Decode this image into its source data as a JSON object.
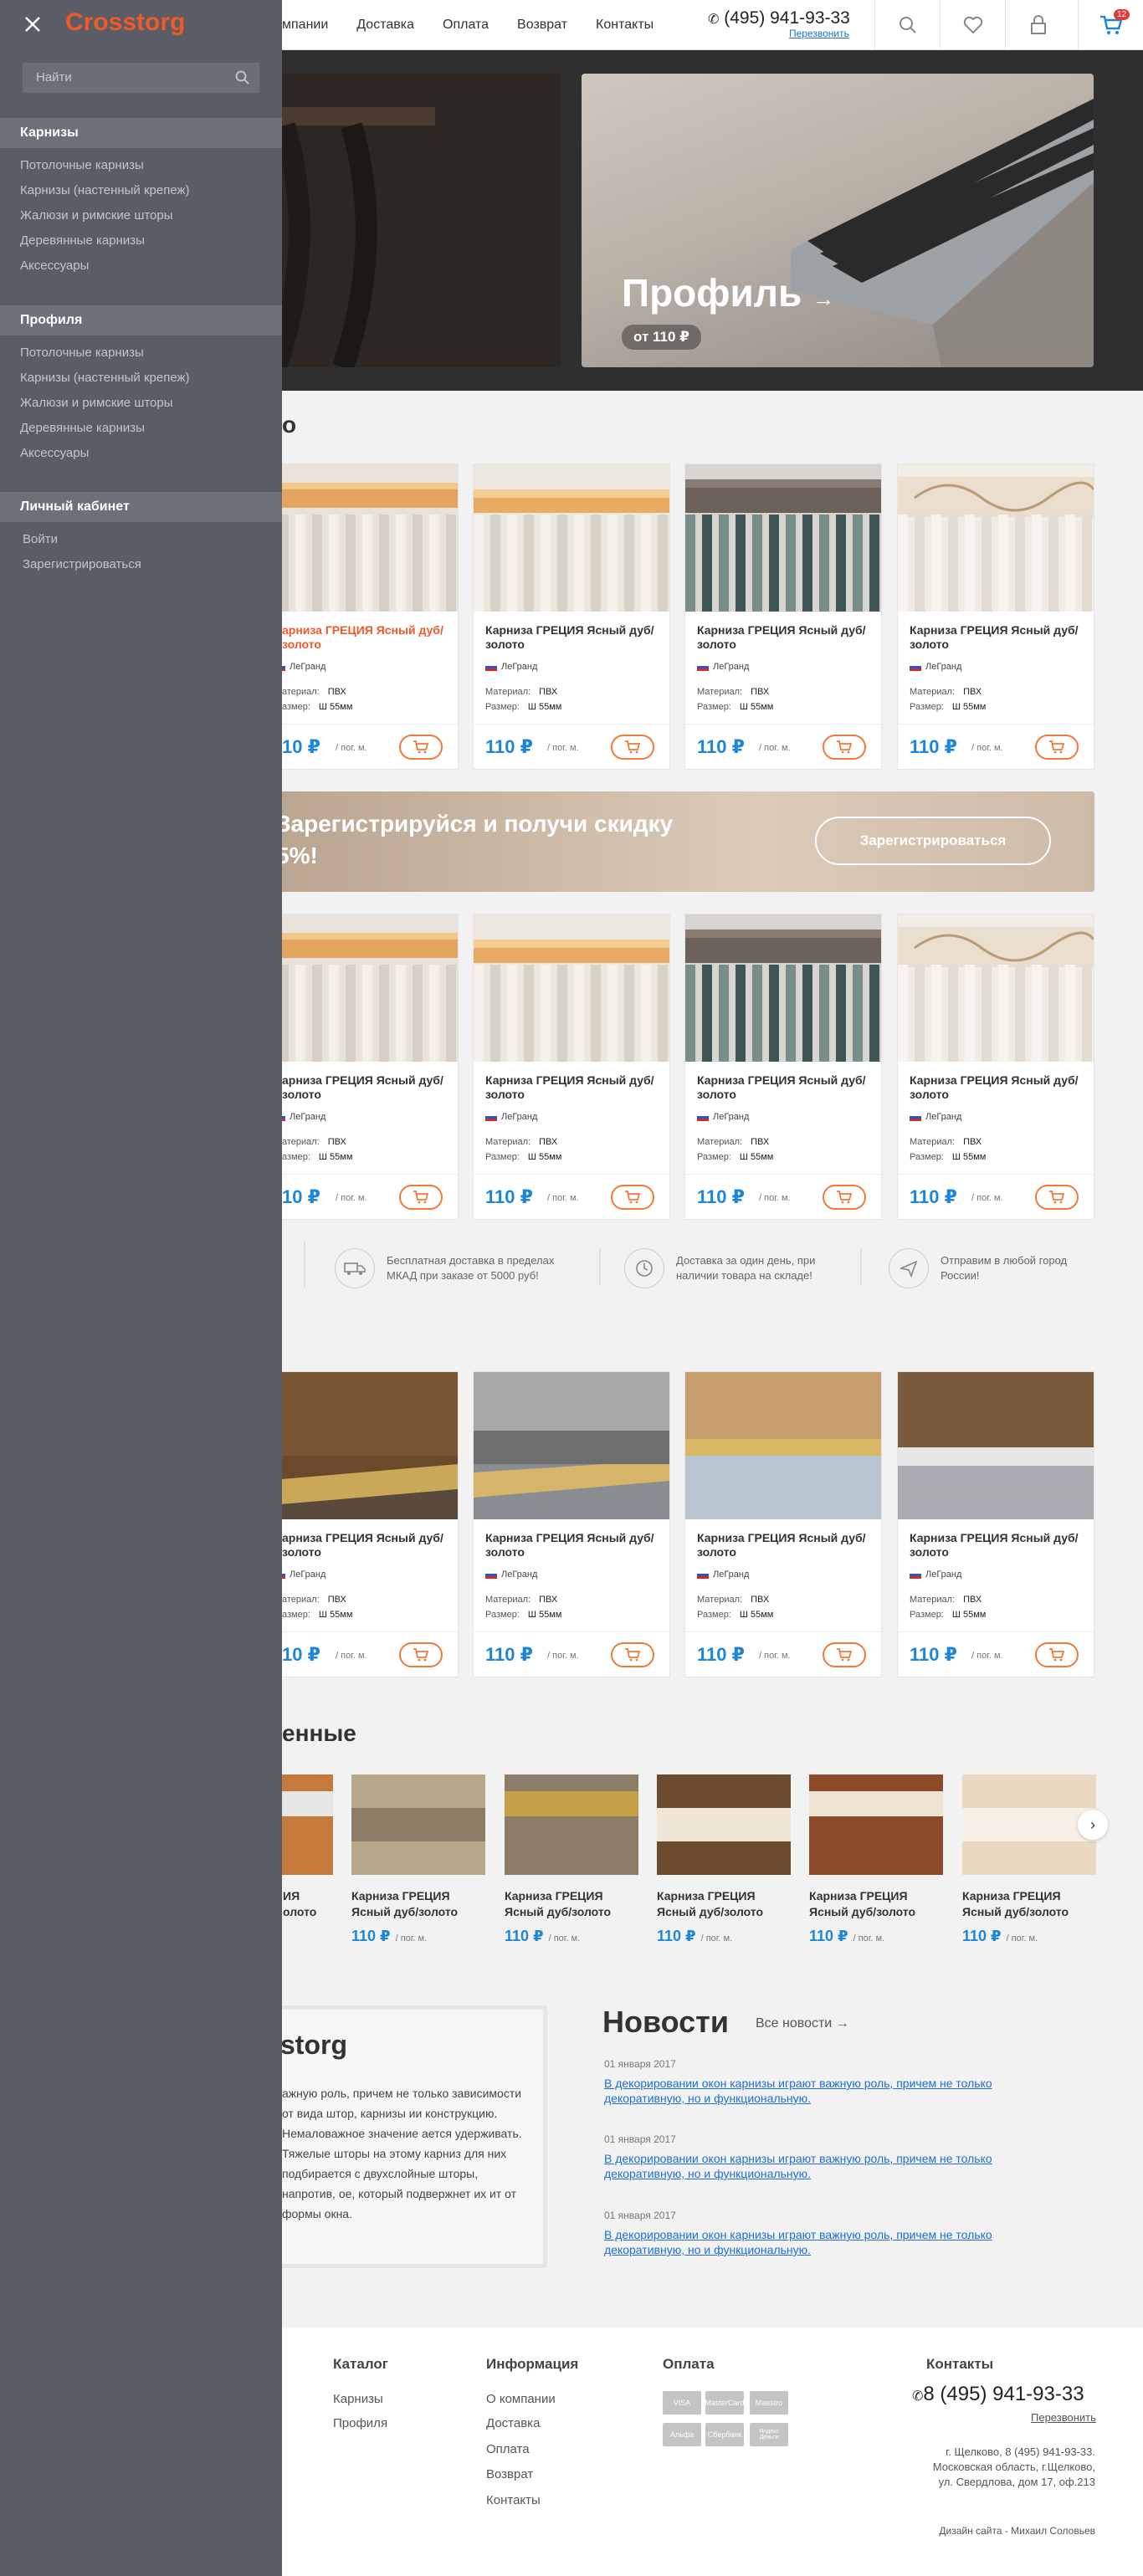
{
  "header": {
    "nav": [
      "О компании",
      "Доставка",
      "Оплата",
      "Возврат",
      "Контакты"
    ],
    "nav_visible": [
      "мпании",
      "Доставка",
      "Оплата",
      "Возврат",
      "Контакты"
    ],
    "phone": "(495) 941-93-33",
    "callback": "Перезвонить",
    "cart_count": "12"
  },
  "hero": {
    "title": "Профиль",
    "price": "от 110 ₽"
  },
  "sections": {
    "first_title": "о",
    "viewed_title": "енные"
  },
  "product": {
    "name": "Карниза ГРЕЦИЯ Ясный дуб/золото",
    "name_cut": "арниза ГРЕЦИЯ Ясный дуб/золото",
    "brand": "ЛеГранд",
    "material_label": "Материал:",
    "material_label_cut": "атериал:",
    "material": "ПВХ",
    "size_label": "Размер:",
    "size_label_cut": "азмер:",
    "size": "Ш 55мм",
    "price": "110 ₽",
    "price_cut": "10 ₽",
    "unit": "/ пог. м."
  },
  "promo": {
    "text": "Зарегистрируйся и получи скидку 5%!",
    "button": "Зарегистрироваться"
  },
  "features": [
    {
      "icon": "truck-icon",
      "text": "Бесплатная доставка в пределах МКАД при заказе от 5000 руб!"
    },
    {
      "icon": "clock-icon",
      "text": "Доставка за один день, при наличии товара на складе!"
    },
    {
      "icon": "plane-icon",
      "text": "Отправим в любой город России!"
    }
  ],
  "small_cards": {
    "name": "Карниза ГРЕЦИЯ Ясный дуб/золото",
    "price": "110 ₽",
    "unit": "/ пог. м.",
    "first_name_cut": "ИЯ\nолото"
  },
  "about": {
    "title": "storg",
    "text": "ажную роль, причем не только зависимости от вида штор, карнизы ии конструкцию. Немаловажное значение ается удерживать. Тяжелые шторы на этому карниз для них подбирается с двухслойные шторы, напротив, ое, который подвержнет их ит от формы окна."
  },
  "news": {
    "title": "Новости",
    "all": "Все новости",
    "items": [
      {
        "date": "01 января 2017",
        "text": "В декорировании окон карнизы играют важную роль, причем не только декоративную, но и функциональную."
      },
      {
        "date": "01 января 2017",
        "text": "В декорировании окон карнизы играют важную роль, причем не только декоративную, но и функциональную."
      },
      {
        "date": "01 января 2017",
        "text": "В декорировании окон карнизы играют важную роль, причем не только декоративную, но и функциональную."
      }
    ]
  },
  "footer": {
    "catalog_title": "Каталог",
    "catalog": [
      "Карнизы",
      "Профиля"
    ],
    "info_title": "Информация",
    "info": [
      "О компании",
      "Доставка",
      "Оплата",
      "Возврат",
      "Контакты"
    ],
    "pay_title": "Оплата",
    "pay": [
      "VISA",
      "MasterCard",
      "Maestro",
      "Альфа",
      "Сбербанк",
      "Яндекс Деньги"
    ],
    "contacts_title": "Контакты",
    "phone": "8 (495) 941-93-33",
    "callback": "Перезвонить",
    "address": "г. Щелково, 8 (495) 941-93-33. Московская область, г.Щелково, ул. Свердлова, дом 17, оф.213",
    "design": "Дизайн сайта - Михаил Соловьев"
  },
  "drawer": {
    "logo": "Crosstorg",
    "search_placeholder": "Найти",
    "sections": [
      {
        "title": "Карнизы",
        "items": [
          "Потолочные карнизы",
          "Карнизы (настенный крепеж)",
          "Жалюзи и римские шторы",
          "Деревянные карнизы",
          "Аксессуары"
        ]
      },
      {
        "title": "Профиля",
        "items": [
          "Потолочные карнизы",
          "Карнизы (настенный крепеж)",
          "Жалюзи и римские шторы",
          "Деревянные карнизы",
          "Аксессуары"
        ]
      },
      {
        "title": "Личный кабинет",
        "items": [
          "Войти",
          "Зарегистрироваться"
        ]
      }
    ]
  },
  "colors": {
    "accent": "#f05a28",
    "price": "#1e86d9",
    "link": "#1e6fd9",
    "drawer": "#5a5c66"
  }
}
